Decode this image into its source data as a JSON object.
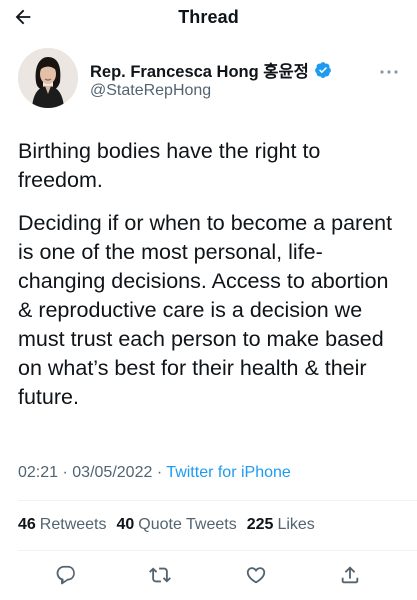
{
  "header": {
    "title": "Thread",
    "back_icon": "arrow-left-icon"
  },
  "author": {
    "display_name": "Rep. Francesca Hong 홍윤정",
    "handle": "@StateRepHong",
    "verified_icon": "verified-badge-icon",
    "verified_color": "#1d9bf0"
  },
  "tweet": {
    "paragraphs": [
      "Birthing bodies have the right to freedom.",
      "Deciding if or when to become a parent is one of the most personal, life-changing decisions. Access to abortion & reproductive care is a decision we must trust each person to make based on what’s best for their health & their future."
    ],
    "time": "02:21",
    "separator": "·",
    "date": "03/05/2022",
    "source": "Twitter for iPhone"
  },
  "stats": {
    "retweets_count": "46",
    "retweets_label": "Retweets",
    "quotes_count": "40",
    "quotes_label": "Quote Tweets",
    "likes_count": "225",
    "likes_label": "Likes"
  },
  "actions": [
    {
      "icon": "reply-icon"
    },
    {
      "icon": "retweet-icon"
    },
    {
      "icon": "like-icon"
    },
    {
      "icon": "share-icon"
    }
  ],
  "colors": {
    "text": "#0f1419",
    "secondary": "#536471",
    "accent": "#1d9bf0",
    "divider": "#eff3f4"
  }
}
